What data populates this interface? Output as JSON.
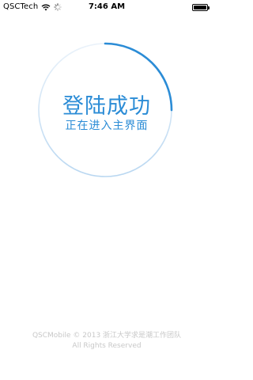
{
  "status_bar": {
    "carrier": "QSCTech",
    "time": "7:46 AM",
    "icons": [
      "wifi-icon",
      "activity-spinner-icon",
      "battery-icon"
    ]
  },
  "main": {
    "title": "登陆成功",
    "subtitle": "正在进入主界面",
    "progress": 0.25
  },
  "footer": {
    "copyright": "QSCMobile © 2013 浙江大学求是潮工作团队",
    "rights": "All Rights Reserved"
  },
  "colors": {
    "accent": "#2b8cd6",
    "ring_light": "#cfe3f5",
    "footer_text": "#c8c8c8"
  }
}
